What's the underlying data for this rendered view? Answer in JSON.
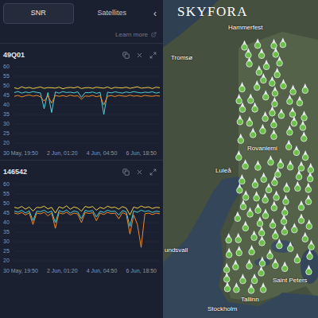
{
  "sidebar": {
    "tabs": [
      {
        "label": "SNR",
        "selected": true
      },
      {
        "label": "Satellites",
        "selected": false
      }
    ],
    "collapse": "‹",
    "learn_more": "Learn more"
  },
  "charts": [
    {
      "title": "49Q01",
      "y_ticks": [
        "60",
        "55",
        "50",
        "45",
        "40",
        "35",
        "30",
        "25",
        "20"
      ],
      "x_ticks": [
        "30 May, 19:50",
        "2 Jun, 01:20",
        "4 Jun, 04:50",
        "6 Jun, 18:50"
      ],
      "series": [
        {
          "color": "#f2cf4a",
          "values": [
            49,
            48.5,
            49.5,
            48.8,
            49.2,
            48.6,
            49,
            49.4,
            48.7,
            49.1,
            49,
            48.8,
            49.3,
            48.5,
            49,
            49.2,
            48.9,
            49.5,
            48.6,
            49,
            49.1,
            48.7,
            49.3,
            49,
            48.8,
            49.4,
            48.6,
            49.2,
            49,
            48.9,
            49.3,
            48.7,
            49.1,
            49.5,
            48.8,
            49,
            49.2,
            48.6,
            49.3,
            49
          ]
        },
        {
          "color": "#4fd1d9",
          "values": [
            46.5,
            47,
            46.2,
            46.8,
            46.4,
            47,
            46.6,
            46.3,
            38,
            46.5,
            36,
            46.8,
            46.2,
            47,
            46.5,
            46.7,
            46.3,
            46.9,
            44,
            46.5,
            46.4,
            46.8,
            46.1,
            46.6,
            35,
            46.7,
            46.3,
            46.9,
            46.5,
            46.2,
            46.8,
            46.4,
            47,
            46.6,
            46.3,
            46.7,
            46.5,
            46.9,
            46.2,
            46.6
          ]
        },
        {
          "color": "#f08a24",
          "values": [
            44.5,
            45,
            44.2,
            44.8,
            45.2,
            44.6,
            45,
            44.3,
            42,
            44.8,
            41,
            45,
            44.5,
            44.9,
            44.4,
            45.1,
            44.6,
            44.8,
            43,
            44.7,
            44.5,
            45,
            44.3,
            44.8,
            40,
            44.6,
            44.9,
            44.4,
            45,
            44.7,
            44.5,
            45.1,
            44.6,
            44.8,
            44.4,
            45,
            44.7,
            44.5,
            44.9,
            44.6
          ]
        }
      ]
    },
    {
      "title": "146542",
      "y_ticks": [
        "60",
        "55",
        "50",
        "45",
        "40",
        "35",
        "30",
        "25",
        "20"
      ],
      "x_ticks": [
        "30 May, 19:50",
        "2 Jun, 01:20",
        "4 Jun, 04:50",
        "6 Jun, 18:50"
      ],
      "series": [
        {
          "color": "#f2cf4a",
          "values": [
            48,
            47.5,
            48.5,
            47,
            48.2,
            46,
            48,
            47.8,
            48.6,
            47.2,
            48,
            45,
            48.3,
            47.5,
            48.8,
            47,
            48.2,
            47.6,
            46,
            48.5,
            47.9,
            48.4,
            46.5,
            48,
            47.3,
            48.6,
            47.8,
            48.1,
            47,
            48.4,
            47.6,
            44,
            48.2,
            47.5,
            48.7,
            47.9,
            48.3,
            47.4,
            48,
            47.8
          ]
        },
        {
          "color": "#4fd1d9",
          "values": [
            46,
            45.5,
            46.4,
            45,
            46.2,
            41,
            46,
            45.7,
            46.5,
            45.2,
            46,
            40,
            46.3,
            45.5,
            46.6,
            45,
            46.1,
            45.6,
            42,
            46.4,
            45.9,
            46.3,
            43,
            46,
            45.3,
            46.5,
            45.8,
            46,
            44,
            46.3,
            45.6,
            38,
            46.1,
            45.4,
            46.5,
            45.8,
            46.2,
            45.3,
            46,
            45.7
          ]
        },
        {
          "color": "#f08a24",
          "values": [
            45,
            44.5,
            45.3,
            44,
            45.1,
            39,
            45,
            44.6,
            45.4,
            43.5,
            45,
            37,
            45.2,
            44.5,
            45.5,
            44,
            45,
            44.5,
            40,
            45.3,
            44.8,
            45.2,
            41,
            45,
            44.2,
            45.4,
            44.7,
            45,
            42,
            45.2,
            44.4,
            34,
            44,
            39,
            27,
            44.6,
            45,
            44.2,
            45,
            44.6
          ]
        }
      ]
    }
  ],
  "map": {
    "logo": "SKYFORA",
    "labels": [
      {
        "text": "Hammerfest"
      },
      {
        "text": "Tromsø"
      },
      {
        "text": "Rovaniemi"
      },
      {
        "text": "Luleå"
      },
      {
        "text": "undsvall"
      },
      {
        "text": "Tallinn"
      },
      {
        "text": "Saint Peters"
      },
      {
        "text": "Stockholm"
      }
    ]
  }
}
